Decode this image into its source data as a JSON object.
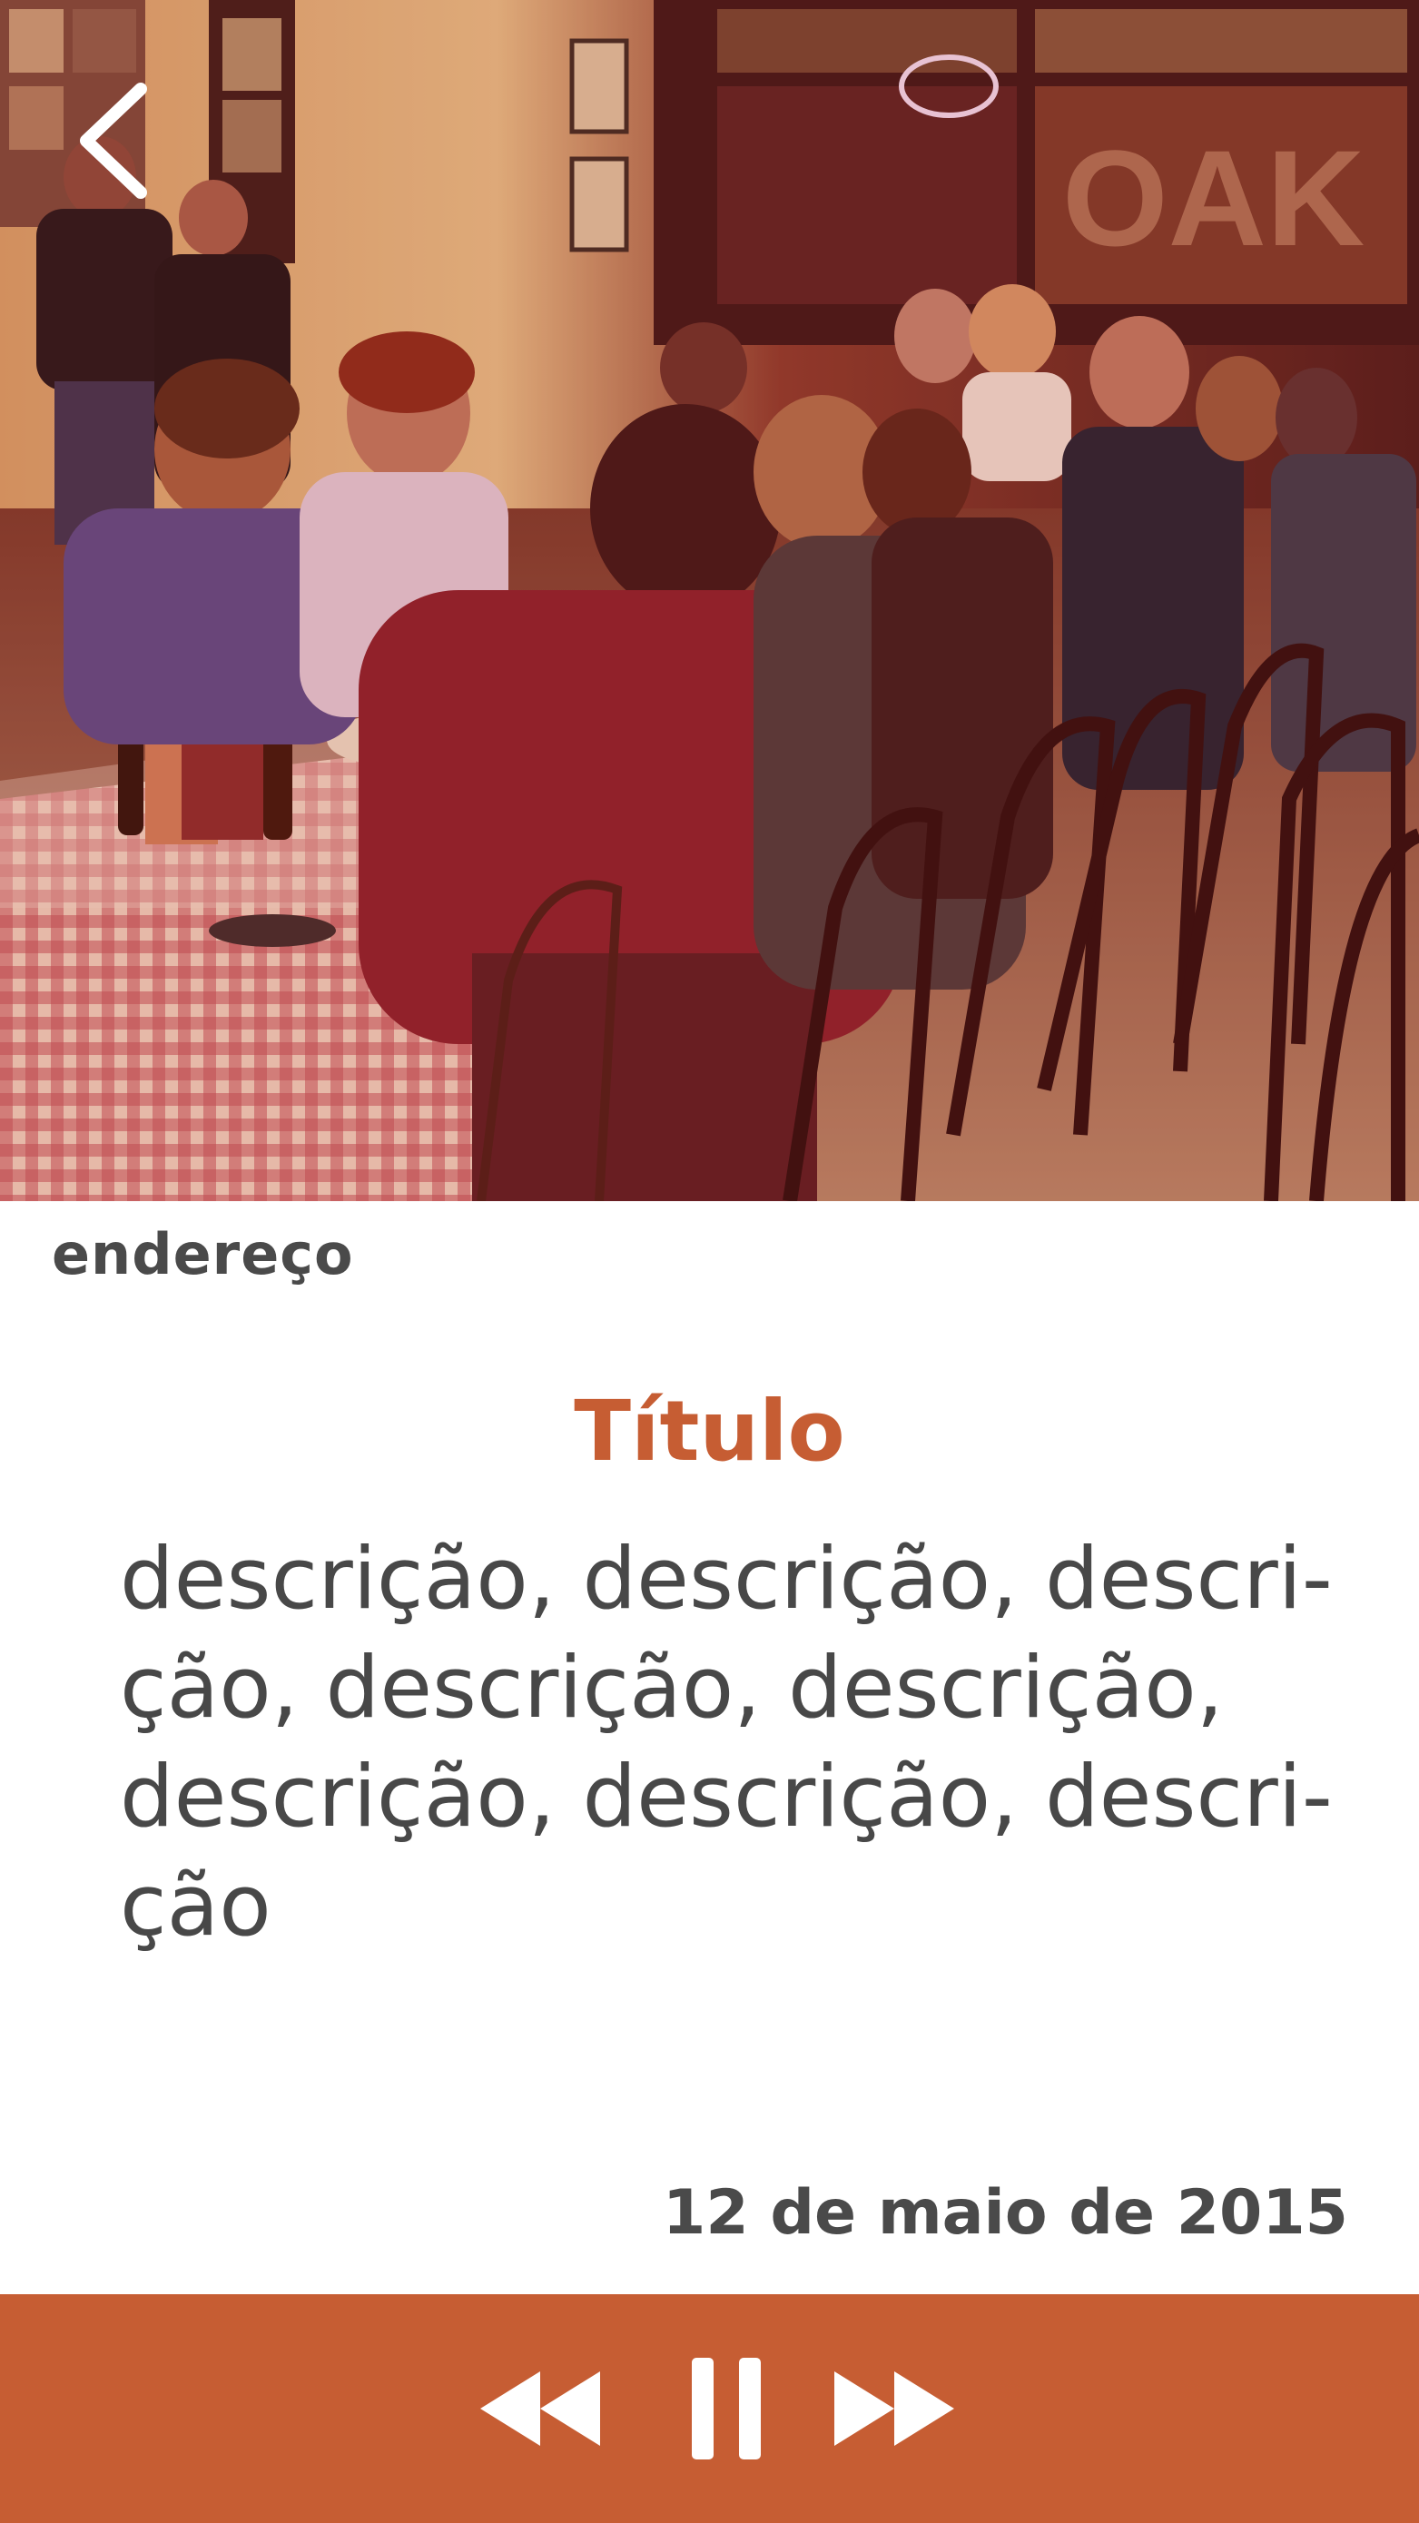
{
  "header": {
    "back_icon": "chevron-left-icon"
  },
  "place": {
    "address": "endereço",
    "title": "Título",
    "description": "descrição, descrição, descri-\nção, descrição, descrição,\ndescrição, descrição, descri-\nção",
    "date": "12 de maio de 2015"
  },
  "player": {
    "rewind_icon": "rewind-icon",
    "pause_icon": "pause-icon",
    "forward_icon": "fast-forward-icon"
  },
  "colors": {
    "accent": "#c65d33",
    "text": "#4a4a4a",
    "background": "#ffffff",
    "icon": "#ffffff"
  }
}
